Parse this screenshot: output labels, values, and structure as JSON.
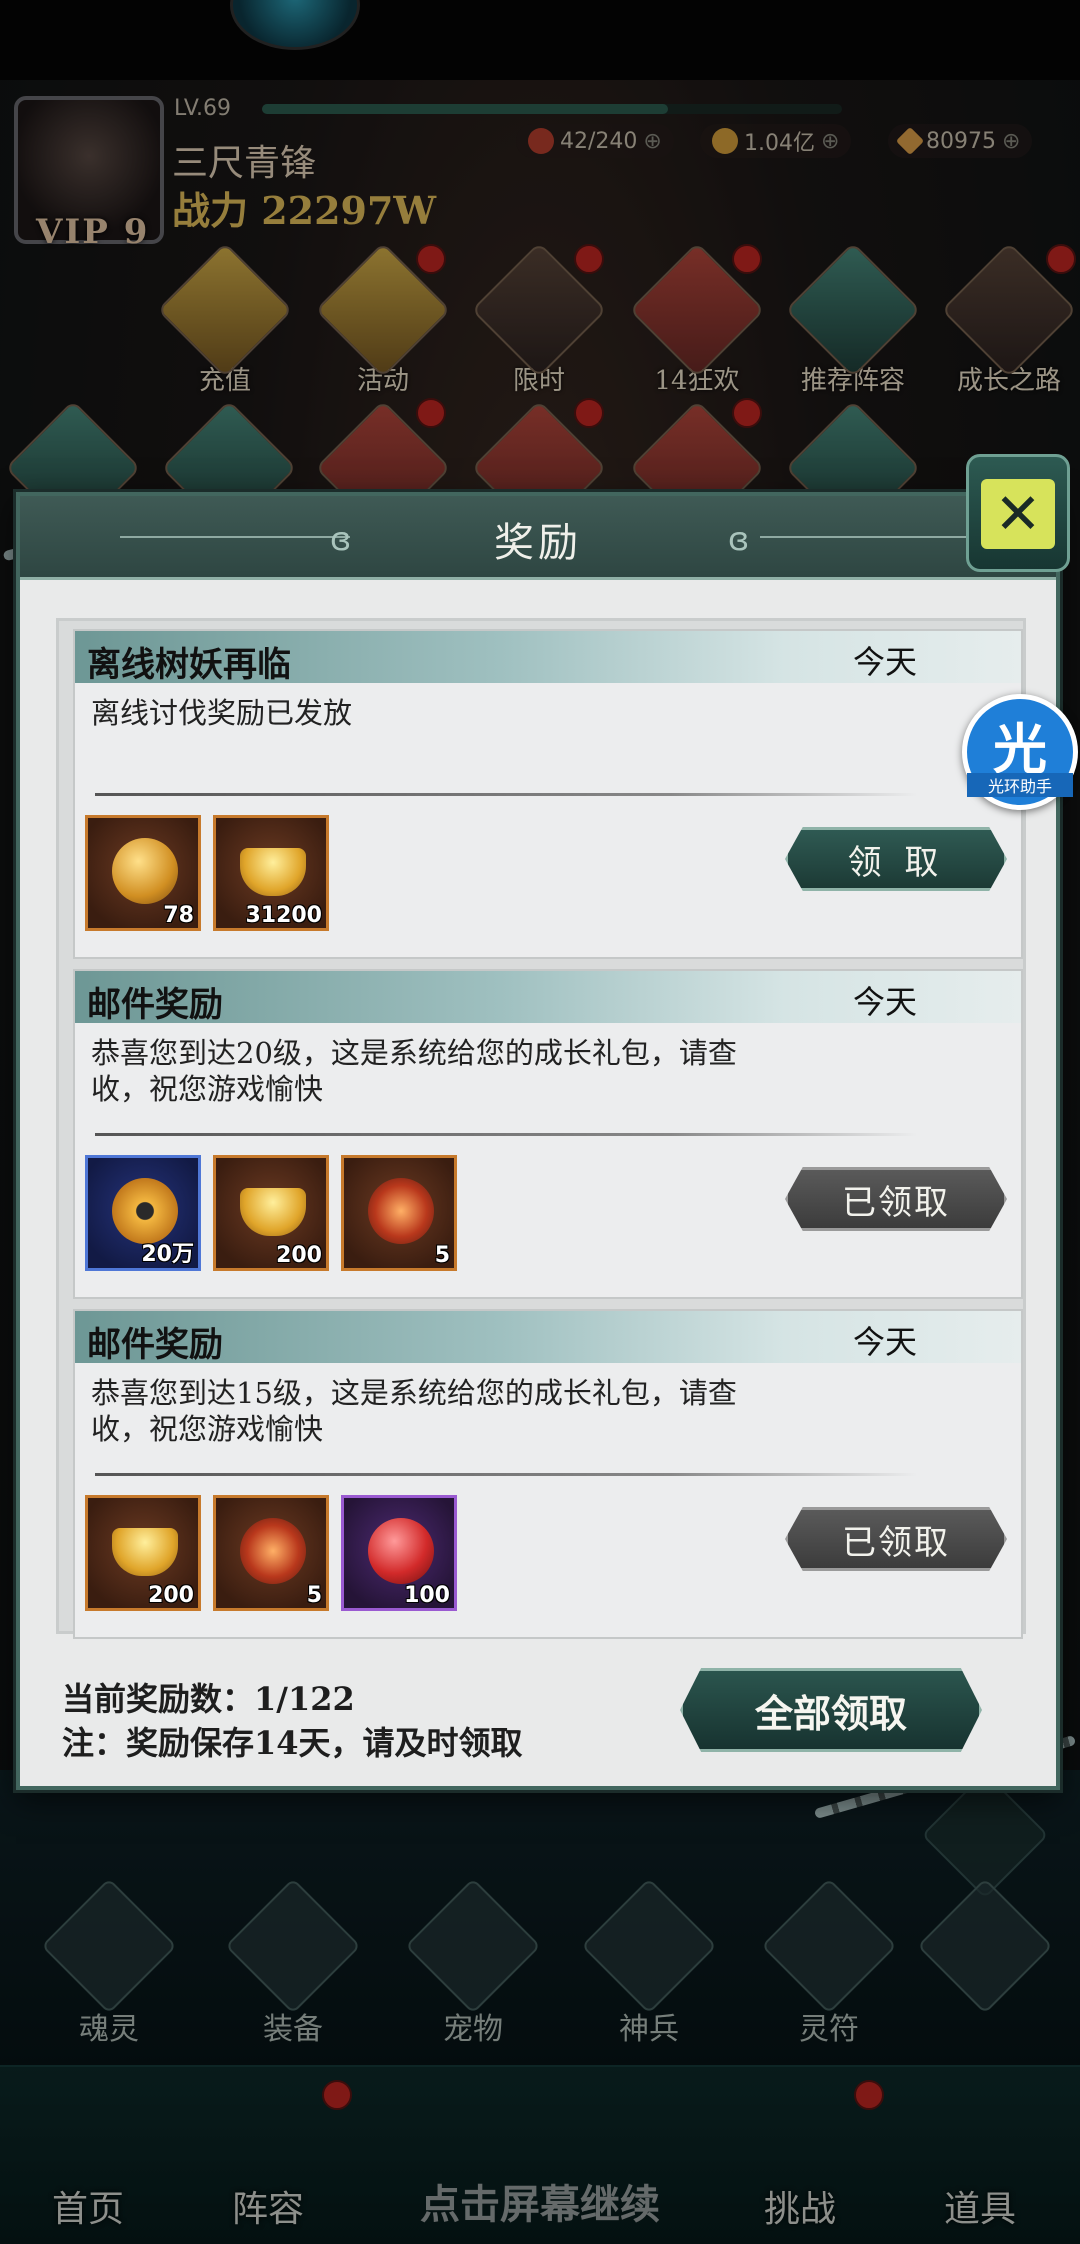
{
  "player": {
    "level": "LV.69",
    "level_progress": 0.7,
    "name": "三尺青锋",
    "power": "战力 22297W",
    "vip": "VIP 9",
    "resources": [
      {
        "icon": "stamina-icon",
        "value": "42/240"
      },
      {
        "icon": "gold-coin-icon",
        "value": "1.04亿"
      },
      {
        "icon": "diamond-icon",
        "value": "80975"
      }
    ]
  },
  "features": [
    "充值",
    "活动",
    "限时",
    "14狂欢",
    "推荐阵容",
    "成长之路"
  ],
  "dialog": {
    "title": "奖励",
    "close_label": "✕",
    "items": [
      {
        "title": "离线树妖再临",
        "date": "今天",
        "body": "离线讨伐奖励已发放",
        "rewards": [
          {
            "icon": "gold-orb-icon",
            "count": "78"
          },
          {
            "icon": "gold-ingot-icon",
            "count": "31200"
          }
        ],
        "button": "领 取",
        "claimed": false
      },
      {
        "title": "邮件奖励",
        "date": "今天",
        "body": "恭喜您到达20级，这是系统给您的成长礼包，请查收，祝您游戏愉快",
        "rewards": [
          {
            "icon": "copper-coin-icon",
            "count": "20万"
          },
          {
            "icon": "gold-ingot-icon",
            "count": "200"
          },
          {
            "icon": "fire-orb-icon",
            "count": "5"
          }
        ],
        "button": "已领取",
        "claimed": true
      },
      {
        "title": "邮件奖励",
        "date": "今天",
        "body": "恭喜您到达15级，这是系统给您的成长礼包，请查收，祝您游戏愉快",
        "rewards": [
          {
            "icon": "gold-ingot-icon",
            "count": "200"
          },
          {
            "icon": "fire-orb-icon",
            "count": "5"
          },
          {
            "icon": "red-pearl-icon",
            "count": "100"
          }
        ],
        "button": "已领取",
        "claimed": true
      }
    ],
    "reward_count": "当前奖励数：1/122",
    "note": "注：奖励保存14天，请及时领取",
    "claim_all": "全部领取"
  },
  "helper": {
    "big": "光",
    "small": "光环助手"
  },
  "lower_features": [
    "魂灵",
    "装备",
    "宠物",
    "神兵",
    "灵符"
  ],
  "nav": [
    "首页",
    "阵容",
    "挑战",
    "道具"
  ],
  "tap_hint": "点击屏幕继续"
}
